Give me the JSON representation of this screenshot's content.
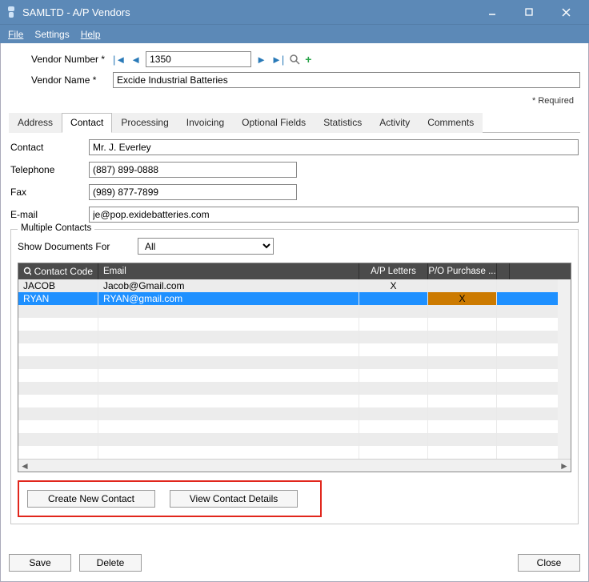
{
  "window": {
    "title": "SAMLTD - A/P Vendors",
    "menus": {
      "file": "File",
      "settings": "Settings",
      "help": "Help"
    }
  },
  "header": {
    "vendor_number_label": "Vendor Number *",
    "vendor_number": "1350",
    "vendor_name_label": "Vendor Name *",
    "vendor_name": "Excide Industrial Batteries",
    "required_note": "* Required"
  },
  "tabs": {
    "address": "Address",
    "contact": "Contact",
    "processing": "Processing",
    "invoicing": "Invoicing",
    "optional_fields": "Optional Fields",
    "statistics": "Statistics",
    "activity": "Activity",
    "comments": "Comments"
  },
  "contact": {
    "labels": {
      "contact": "Contact",
      "telephone": "Telephone",
      "fax": "Fax",
      "email": "E-mail"
    },
    "name": "Mr. J. Everley",
    "telephone": "(887) 899-0888",
    "fax": "(989) 877-7899",
    "email": "je@pop.exidebatteries.com"
  },
  "multi": {
    "legend": "Multiple Contacts",
    "show_docs_label": "Show Documents For",
    "show_docs_value": "All",
    "columns": {
      "code": "Contact Code",
      "email": "Email",
      "ap": "A/P Letters",
      "po": "P/O Purchase ..."
    },
    "rows": [
      {
        "code": "JACOB",
        "email": "Jacob@Gmail.com",
        "ap": "X",
        "po": "",
        "selected": false
      },
      {
        "code": "RYAN",
        "email": "RYAN@gmail.com",
        "ap": "",
        "po": "X",
        "selected": true
      }
    ],
    "buttons": {
      "create": "Create New Contact",
      "view": "View Contact Details"
    }
  },
  "footer": {
    "save": "Save",
    "delete": "Delete",
    "close": "Close"
  }
}
